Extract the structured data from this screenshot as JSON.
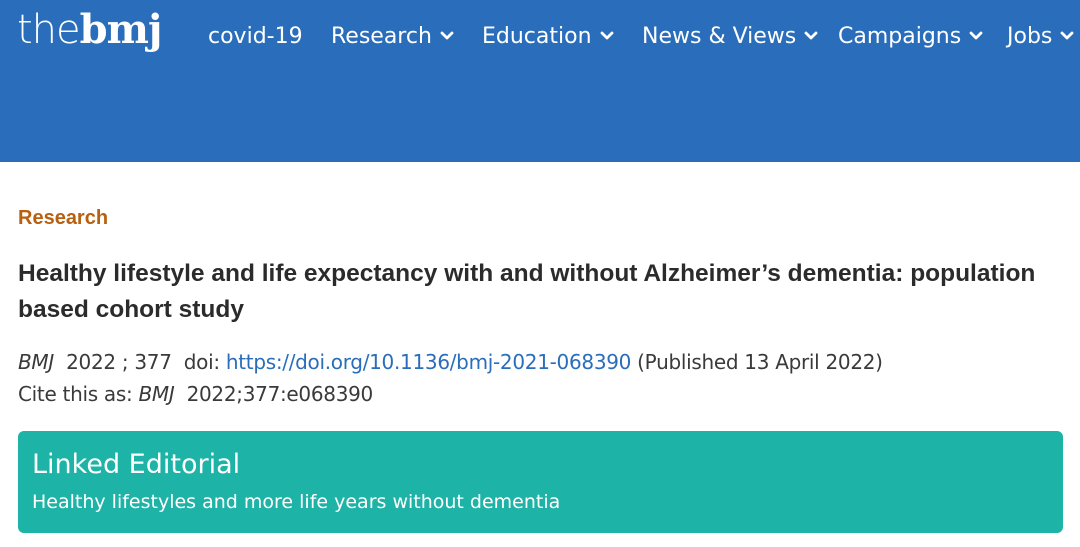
{
  "header": {
    "logo": {
      "the": "the",
      "bmj": "bmj"
    },
    "colors": {
      "background": "#2a6ebb",
      "text": "#ffffff"
    },
    "nav": [
      {
        "label": "covid-19",
        "has_dropdown": false
      },
      {
        "label": "Research",
        "has_dropdown": true,
        "icon": "chevron-down-icon"
      },
      {
        "label": "Education",
        "has_dropdown": true,
        "icon": "chevron-down-icon"
      },
      {
        "label": "News & Views",
        "has_dropdown": true,
        "icon": "chevron-down-icon"
      },
      {
        "label": "Campaigns",
        "has_dropdown": true,
        "icon": "chevron-down-icon"
      },
      {
        "label": "Jobs",
        "has_dropdown": true,
        "icon": "chevron-down-icon"
      }
    ]
  },
  "article": {
    "section": "Research",
    "section_color": "#b85f10",
    "title": "Healthy lifestyle and life expectancy with and without Alzheimer’s dementia: population based cohort study",
    "citation": {
      "journal": "BMJ",
      "year_volume": "2022 ; 377",
      "doi_label": "doi:",
      "doi_url": "https://doi.org/10.1136/bmj-2021-068390",
      "published": "(Published 13 April 2022)",
      "cite_label": "Cite this as:",
      "cite_journal": "BMJ",
      "cite_ref": "2022;377:e068390"
    }
  },
  "linked_editorial": {
    "heading": "Linked Editorial",
    "link_text": "Healthy lifestyles and more life years without dementia",
    "color": "#1db3a6"
  }
}
